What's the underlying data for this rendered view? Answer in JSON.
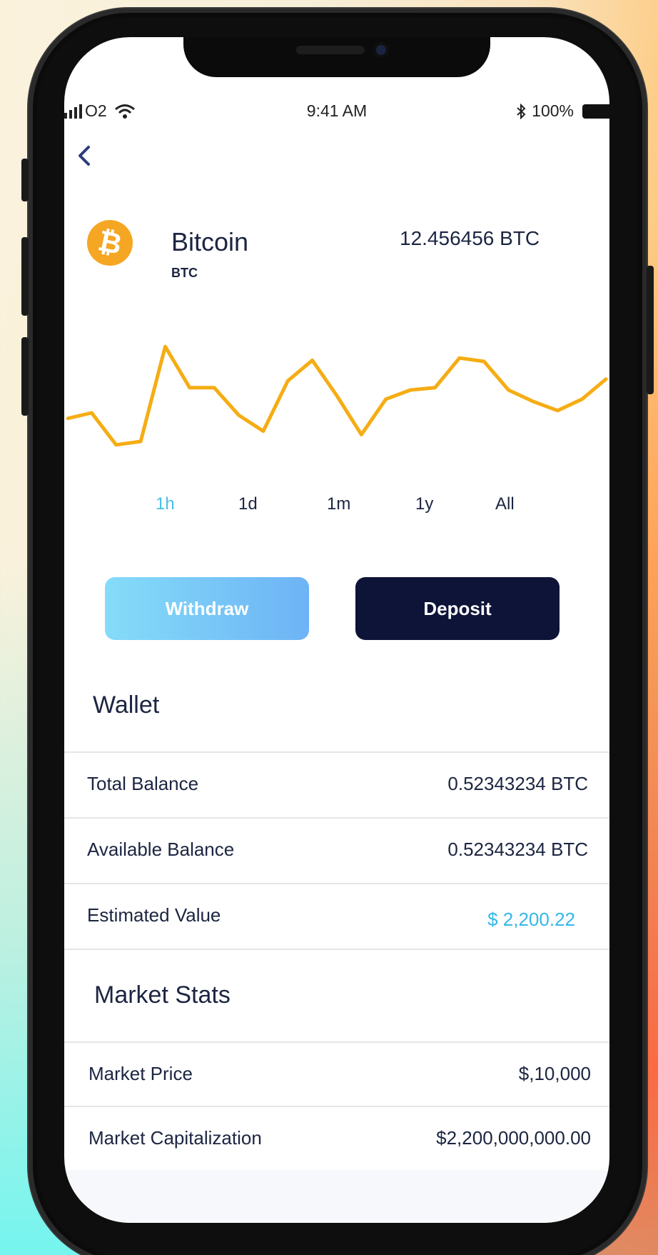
{
  "status_bar": {
    "carrier": "O2",
    "time": "9:41 AM",
    "battery": "100%",
    "icons": [
      "signal-icon",
      "wifi-icon",
      "bluetooth-icon",
      "battery-icon"
    ]
  },
  "header": {
    "back_icon": "chevron-left-icon"
  },
  "coin": {
    "name": "Bitcoin",
    "symbol": "BTC",
    "logo_glyph": "₿",
    "holding": "12.456456 BTC"
  },
  "chart_data": {
    "type": "line",
    "series": [
      {
        "values": [
          0.35,
          0.4,
          0.12,
          0.15,
          0.98,
          0.62,
          0.62,
          0.38,
          0.24,
          0.68,
          0.86,
          0.55,
          0.21,
          0.52,
          0.6,
          0.62,
          0.88,
          0.85,
          0.6,
          0.5,
          0.42,
          0.52,
          0.7
        ]
      }
    ],
    "color": "#f5ad14"
  },
  "time_ranges": {
    "items": [
      "1h",
      "1d",
      "1m",
      "1y",
      "All"
    ],
    "active": "1h"
  },
  "actions": {
    "withdraw": "Withdraw",
    "deposit": "Deposit"
  },
  "wallet": {
    "title": "Wallet",
    "rows": [
      {
        "label": "Total Balance",
        "value": "0.52343234 BTC"
      },
      {
        "label": "Available Balance",
        "value": "0.52343234 BTC"
      },
      {
        "label": "Estimated Value",
        "value": "$ 2,200.22"
      }
    ]
  },
  "market": {
    "title": "Market Stats",
    "rows": [
      {
        "label": "Market Price",
        "value": "$,10,000"
      },
      {
        "label": "Market Capitalization",
        "value": "$2,200,000,000.00"
      }
    ]
  },
  "colors": {
    "accent": "#45c0e8",
    "navy": "#0e1437",
    "chart": "#f5ad14",
    "coin": "#f5a623"
  }
}
